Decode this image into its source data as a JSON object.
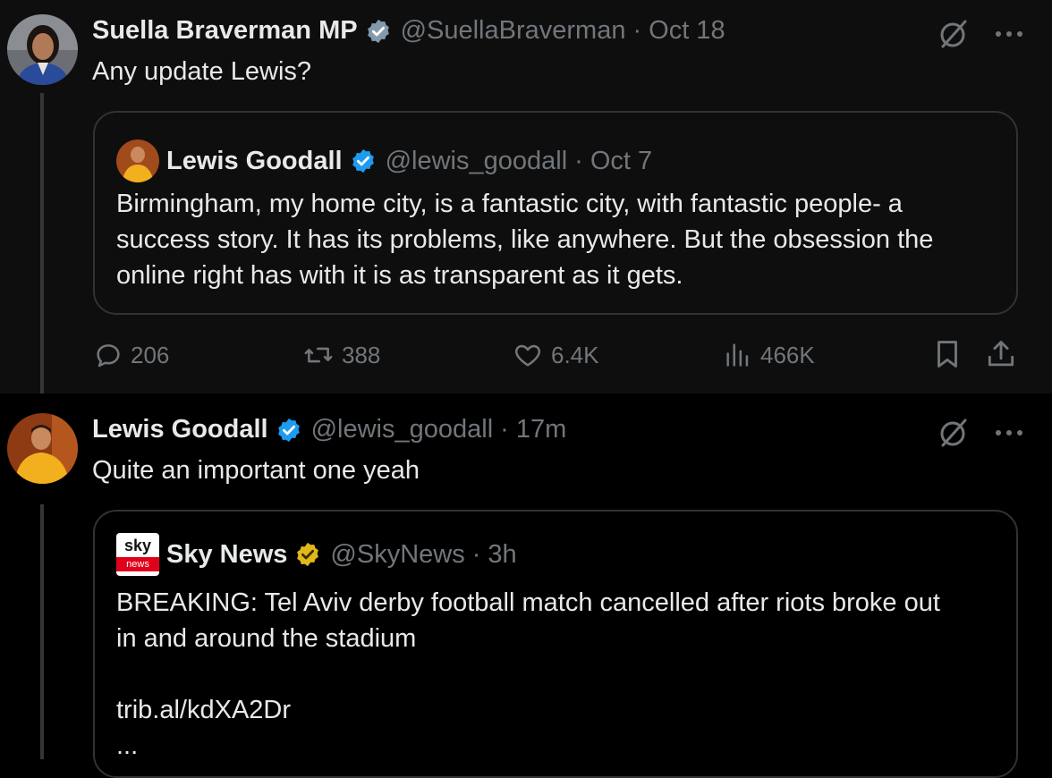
{
  "tweet1": {
    "author_name": "Suella Braverman MP",
    "author_handle": "@SuellaBraverman",
    "separator": "·",
    "time": "Oct 18",
    "text": "Any update Lewis?",
    "quote": {
      "author_name": "Lewis Goodall",
      "author_handle": "@lewis_goodall",
      "separator": "·",
      "time": "Oct 7",
      "lines": [
        "Birmingham, my home city, is a fantastic city, with fantastic people- a",
        "success story. It has its problems, like anywhere. But the obsession the",
        "online right has with it is as transparent as it gets."
      ]
    },
    "stats": {
      "replies": "206",
      "reposts": "388",
      "likes": "6.4K",
      "views": "466K"
    }
  },
  "tweet2": {
    "author_name": "Lewis Goodall",
    "author_handle": "@lewis_goodall",
    "separator": "·",
    "time": "17m",
    "text": "Quite an important one yeah",
    "quote": {
      "author_name": "Sky News",
      "author_handle": "@SkyNews",
      "separator": "·",
      "time": "3h",
      "logo_top": "sky",
      "logo_bottom": "news",
      "lines": [
        "BREAKING: Tel Aviv derby football match cancelled after riots broke out",
        "in and around the stadium",
        "",
        "trib.al/kdXA2Dr",
        "..."
      ]
    }
  },
  "icons": {
    "verified_blue": "verified-badge-blue",
    "verified_gold": "verified-badge-gold",
    "grok": "grok-icon",
    "more": "more-icon",
    "reply": "reply-icon",
    "repost": "repost-icon",
    "like": "like-icon",
    "views": "views-icon",
    "bookmark": "bookmark-icon",
    "share": "share-icon"
  },
  "colors": {
    "background": "#000000",
    "text": "#e7e9ea",
    "muted": "#71767b",
    "verified_blue": "#1d9bf0",
    "verified_gold": "#e2b719",
    "sky_red": "#e1001a"
  }
}
